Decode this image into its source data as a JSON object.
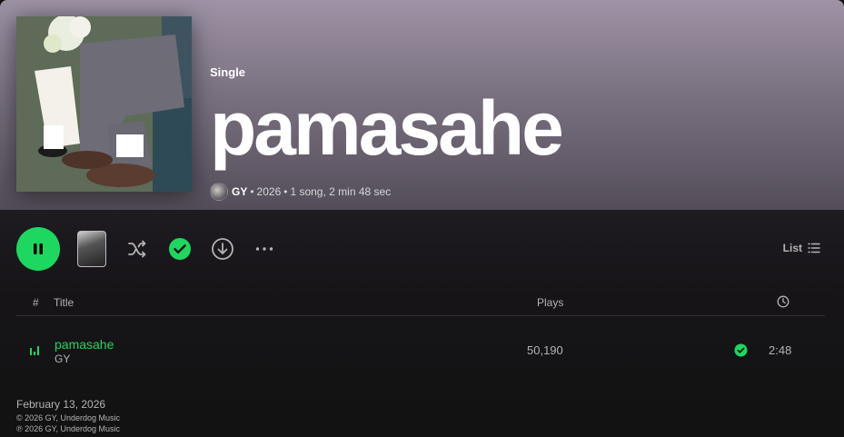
{
  "album": {
    "type_label": "Single",
    "title": "pamasahe",
    "artist": "GY",
    "year": "2026",
    "summary": "1 song, 2 min 48 sec"
  },
  "actions": {
    "play_state": "pause-icon",
    "accent": "#1ed760",
    "view_label": "List"
  },
  "table": {
    "columns": {
      "index": "#",
      "title": "Title",
      "plays": "Plays"
    },
    "rows": [
      {
        "title": "pamasahe",
        "artist": "GY",
        "plays": "50,190",
        "duration": "2:48",
        "saved": true,
        "playing": true
      }
    ]
  },
  "footer": {
    "release_date": "February 13, 2026",
    "copyright": "© 2026 GY, Underdog Music",
    "phonographic": "℗ 2026 GY, Underdog Music"
  }
}
